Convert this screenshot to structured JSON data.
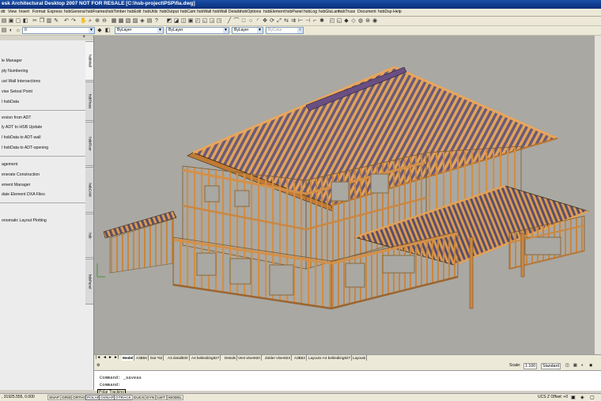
{
  "title": "esk Architectural Desktop 2007   NOT FOR RESALE  [C:\\hsb-project\\PSP\\fia.dwg]",
  "menu": [
    "dit",
    "View",
    "Insert",
    "Format",
    "Express",
    "hsbGeneral",
    "hsbFrames",
    "hsbTimber",
    "hsbEdit",
    "hsbUtils",
    "hsbOutput",
    "hsbCam",
    "hsbWall",
    "hsbWall Details",
    "hsbOptions",
    "hsbElement",
    "hsbPanel",
    "hsbLog",
    "hsbGluLam",
    "hsbTruss",
    "Document",
    "hsbDsp",
    "Help"
  ],
  "toolbar2": {
    "layer_value": "0",
    "color_value": "ByLayer",
    "linetype_value": "ByLayer",
    "lineweight_value": "ByLayer",
    "plotstyle_value": "ByColor"
  },
  "palette": {
    "close_glyph": "×",
    "items": [
      "le Manager",
      "ply Numbering",
      "ust Wall Intersections",
      "vise Setout Point",
      "l hsbData",
      "ersion from ADT",
      "ly ADT to HSB Update",
      "l hsbData to ADT-wall",
      "l hsbData to ADT-opening",
      "agement",
      "enerate Construction",
      "ement Manager",
      "date Element DXA Files",
      "onomatic Layout Plotting"
    ],
    "tabs": [
      "hsbWall",
      "hsbTruss",
      "hsbFloor",
      "hsbCAM",
      "hsb",
      "hsbPanel"
    ]
  },
  "layout_nav": [
    "|◄",
    "◄",
    "►",
    "►|"
  ],
  "layout_tabs": [
    "Model",
    "A3B56",
    "Dat *62",
    "A3 detail830",
    "A4 beklediing827",
    "Details",
    "Vest vloer820",
    "Zolder vloer823",
    "A3B53",
    "Layout1-A4 beklediing827",
    "Layout2"
  ],
  "status_row": {
    "scale_label": "Scale:",
    "scale_value": "1:100",
    "standard": "Standard"
  },
  "command_lines": [
    "Command:  _saveas",
    "Command:"
  ],
  "tooltip": "Polar Tracking",
  "statusbar": {
    "coords": ", 31925.555, 0.000",
    "buttons": [
      "SNAP",
      "GRID",
      "ORTHO",
      "POLAR",
      "OSNAP",
      "OTRACK",
      "DUCS",
      "DYN",
      "LWT",
      "MODEL"
    ],
    "ucs": "UCS Z Offset:  +0"
  }
}
